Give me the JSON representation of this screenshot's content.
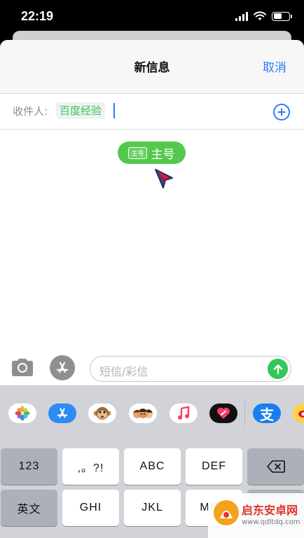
{
  "status_bar": {
    "time": "22:19",
    "battery_level": 0.55,
    "icons": [
      "signal-icon",
      "wifi-icon",
      "battery-icon"
    ]
  },
  "nav": {
    "title": "新信息",
    "cancel_label": "取消"
  },
  "recipient_row": {
    "label": "收件人:",
    "recipient": "百度经验",
    "add_icon": "plus-circle-icon"
  },
  "sim_selector": {
    "badge": "主号",
    "label": "主号"
  },
  "composer": {
    "camera_icon": "camera-icon",
    "apps_icon": "app-store-icon",
    "placeholder": "短信/彩信",
    "send_icon": "arrow-up-icon"
  },
  "app_drawer": {
    "apps": [
      "photos-icon",
      "app-store-icon",
      "monkey-emoji-icon",
      "memoji-icon",
      "music-icon",
      "digital-touch-icon",
      "alipay-icon"
    ],
    "alipay_glyph": "支"
  },
  "keyboard": {
    "row1": [
      "123",
      ",。?!",
      "ABC",
      "DEF"
    ],
    "row2": [
      "英文",
      "GHI",
      "JKL",
      "MNO"
    ],
    "delete_icon": "backspace-icon"
  },
  "watermark": {
    "name": "启东安卓网",
    "url": "www.qdltdq.com"
  },
  "colors": {
    "accent": "#2f7cf6",
    "green": "#34c759",
    "sim_green": "#54c84c"
  }
}
